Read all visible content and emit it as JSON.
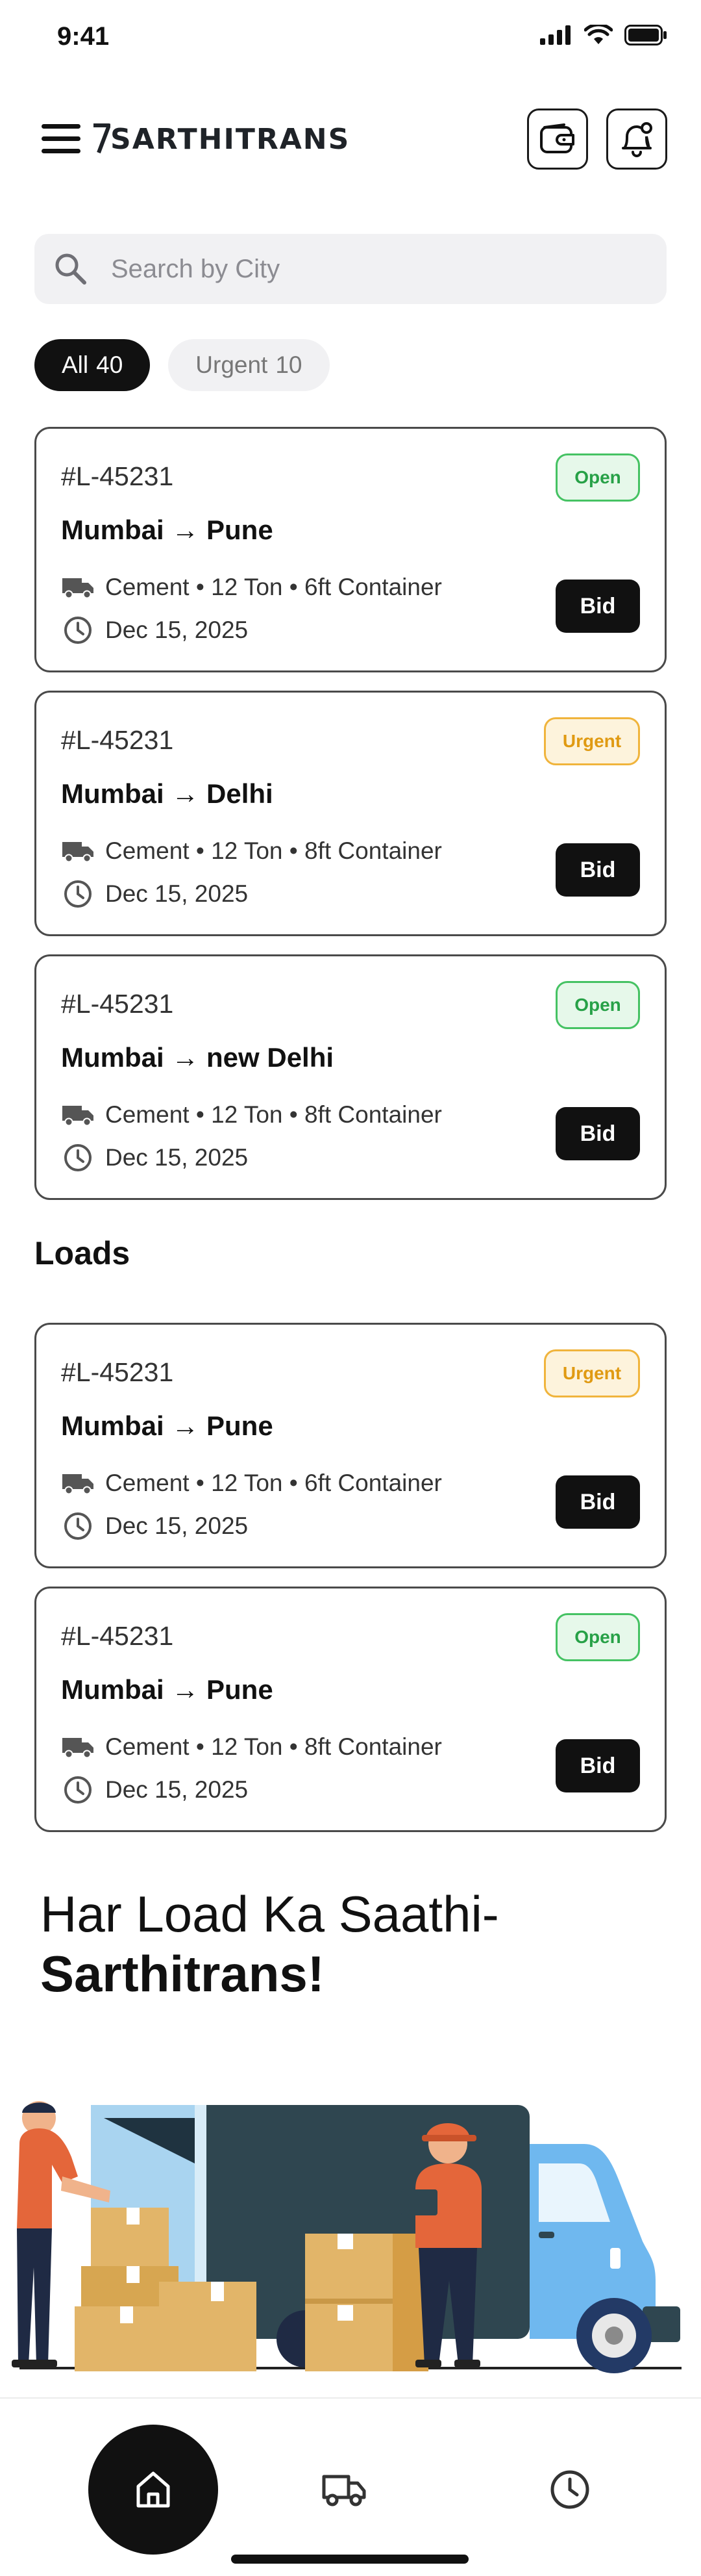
{
  "status_bar": {
    "time": "9:41"
  },
  "header": {
    "logo_text": "SARTHITRANS"
  },
  "search": {
    "placeholder": "Search by City"
  },
  "filters": [
    {
      "label": "All",
      "count": "40",
      "active": true
    },
    {
      "label": "Urgent",
      "count": "10",
      "active": false
    }
  ],
  "top_loads": [
    {
      "id": "#L-45231",
      "route": "Mumbai → Pune",
      "details": "Cement • 12 Ton • 6ft Container",
      "date": "Dec 15, 2025",
      "status": "Open",
      "bid_label": "Bid"
    },
    {
      "id": "#L-45231",
      "route": "Mumbai → Delhi",
      "details": "Cement • 12 Ton • 8ft Container",
      "date": "Dec 15, 2025",
      "status": "Urgent",
      "bid_label": "Bid"
    },
    {
      "id": "#L-45231",
      "route": "Mumbai → new Delhi",
      "details": "Cement • 12 Ton • 8ft Container",
      "date": "Dec 15, 2025",
      "status": "Open",
      "bid_label": "Bid"
    }
  ],
  "loads_section": {
    "title": "Loads",
    "items": [
      {
        "id": "#L-45231",
        "route": "Mumbai → Pune",
        "details": "Cement • 12 Ton • 6ft Container",
        "date": "Dec 15, 2025",
        "status": "Urgent",
        "bid_label": "Bid"
      },
      {
        "id": "#L-45231",
        "route": "Mumbai → Pune",
        "details": "Cement • 12 Ton • 8ft Container",
        "date": "Dec 15, 2025",
        "status": "Open",
        "bid_label": "Bid"
      }
    ]
  },
  "tagline": {
    "line1": "Har Load Ka Saathi-",
    "line2": "Sarthitrans!"
  },
  "colors": {
    "open_green": "#27a147",
    "urgent_amber": "#e09a12",
    "primary": "#111111"
  },
  "bottom_nav": {
    "items": [
      "home-icon",
      "truck-icon",
      "clock-icon"
    ]
  }
}
